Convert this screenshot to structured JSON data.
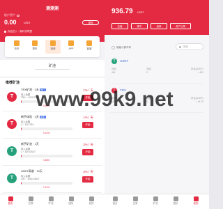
{
  "left": {
    "title": "测测测",
    "asset_label": "账户资产",
    "amount": "0.00",
    "unit": "USDT",
    "withdraw_label": "提现",
    "notice": "欢迎进入一鼎科技联盟",
    "menu": [
      {
        "label": "充币",
        "icon": "coin-deposit-icon"
      },
      {
        "label": "提币",
        "icon": "coin-withdraw-icon"
      },
      {
        "label": "邀请",
        "icon": "invite-icon"
      },
      {
        "label": "APP",
        "icon": "app-icon"
      },
      {
        "label": "客服",
        "icon": "service-icon"
      }
    ],
    "section_title": "矿池",
    "list_title": "推荐矿池",
    "mining_items": [
      {
        "name": "TRX矿池 · 1天",
        "tag": "热门",
        "rate": "1% / 天",
        "sub": "收入余额",
        "range": "TRX ~ 1000 TRX",
        "percent_label": "0.65%",
        "progress": 0.0065,
        "button": "开始",
        "coin": "T"
      },
      {
        "name": "新手体验 · 1天",
        "tag": "新手",
        "rate": "1% / 天",
        "sub": "收入余额",
        "range": "1 ~ 100 TRX",
        "percent_label": "0.01%",
        "progress": 0.0001,
        "button": "开始",
        "coin": "T"
      },
      {
        "name": "新手矿池 · 1天",
        "tag": "",
        "rate": "3% / 天",
        "sub": "收入余额",
        "range": "1 ~ 100 USDT",
        "percent_label": "0.58%",
        "progress": 0.0058,
        "button": "开始",
        "coin": "T"
      },
      {
        "name": "USDT高收 · 10天",
        "tag": "",
        "rate": "3% / 天",
        "sub": "收入余额",
        "range": "100 ~ 1000 USDT",
        "percent_label": "1.11%",
        "progress": 0.0111,
        "button": "开始",
        "coin": "T"
      }
    ],
    "tabs": [
      {
        "label": "首页",
        "active": true
      },
      {
        "label": "交易",
        "active": false
      },
      {
        "label": "矿池",
        "active": false
      },
      {
        "label": "团队",
        "active": false
      },
      {
        "label": "我的",
        "active": false
      }
    ]
  },
  "right": {
    "amount": "936.79",
    "unit": "USDT",
    "buttons": [
      "充值",
      "提币",
      "划转",
      "资产记录"
    ],
    "hide_label": "隐藏小额币种",
    "search_placeholder": "搜索",
    "assets": [
      {
        "name": "USDT",
        "coin": "T",
        "color": "#26a17b",
        "row1": [
          "可用",
          "冻结",
          "折合(USDT)"
        ],
        "row2": [
          "461",
          "0",
          "≈ 461"
        ]
      },
      {
        "name": "TRX",
        "coin": "T",
        "color": "#e32a42",
        "row1": [
          "可用",
          "冻结",
          "折合(USDT)"
        ],
        "row2": [
          "1200",
          "0",
          "≈ 44.79"
        ]
      }
    ],
    "tabs": [
      {
        "label": "首页",
        "active": false
      },
      {
        "label": "交易",
        "active": false
      },
      {
        "label": "矿池",
        "active": false
      },
      {
        "label": "团队",
        "active": false
      },
      {
        "label": "我的",
        "active": true
      }
    ]
  },
  "watermark": "www.99k9.net",
  "colors": {
    "accent": "#e32a42",
    "usdt": "#26a17b",
    "link": "#4c72d1"
  }
}
